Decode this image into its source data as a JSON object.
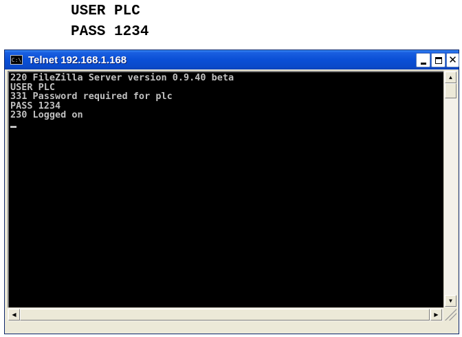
{
  "caption": {
    "line1": "USER PLC",
    "line2": "PASS 1234"
  },
  "window": {
    "title": "Telnet 192.168.1.168",
    "icon": "console-app-icon"
  },
  "controls": {
    "minimize": "minimize-icon",
    "maximize": "maximize-icon",
    "close": "close-icon"
  },
  "console": {
    "lines": [
      "220 FileZilla Server version 0.9.40 beta",
      "USER PLC",
      "331 Password required for plc",
      "PASS 1234",
      "230 Logged on"
    ]
  },
  "scrollbar": {
    "up": "scroll-up-arrow-icon",
    "down": "scroll-down-arrow-icon",
    "left": "scroll-left-arrow-icon",
    "right": "scroll-right-arrow-icon"
  }
}
